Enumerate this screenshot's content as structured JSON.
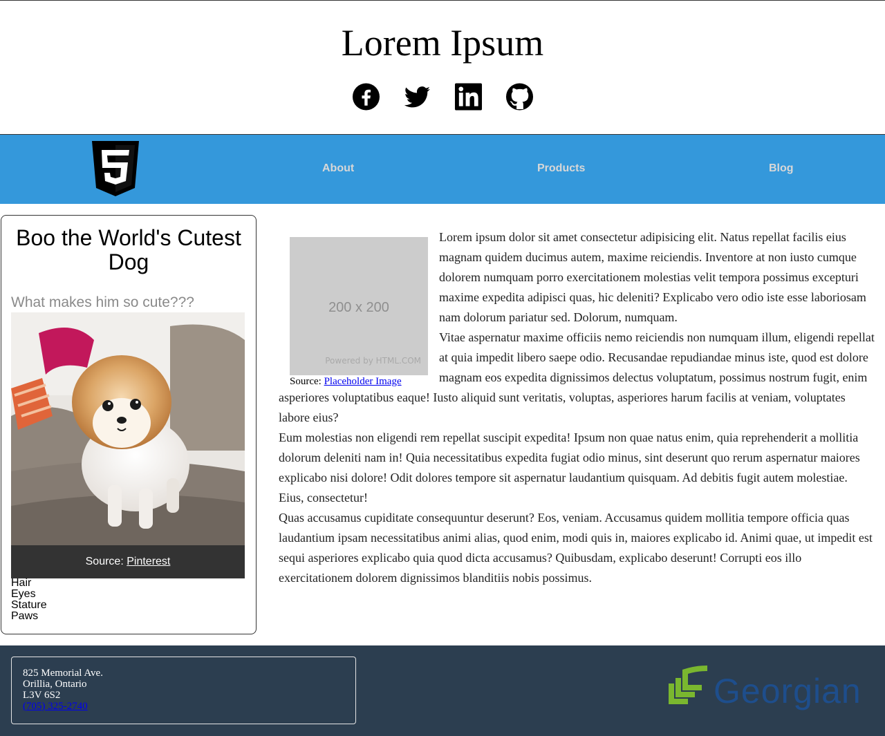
{
  "header": {
    "title": "Lorem Ipsum",
    "social": [
      "facebook-icon",
      "twitter-icon",
      "linkedin-icon",
      "github-icon"
    ]
  },
  "nav": {
    "logo_icon": "html5-icon",
    "links": [
      "About",
      "Products",
      "Blog"
    ]
  },
  "aside": {
    "title": "Boo the World's Cutest Dog",
    "subtitle": "What makes him so cute???",
    "caption_prefix": "Source: ",
    "caption_link": "Pinterest",
    "traits": [
      "Hair",
      "Eyes",
      "Stature",
      "Paws"
    ]
  },
  "article": {
    "placeholder_size": "200 x 200",
    "placeholder_powered": "Powered by HTML.COM",
    "placeholder_caption_prefix": "Source: ",
    "placeholder_caption_link": "Placeholder Image",
    "paragraphs": [
      "Lorem ipsum dolor sit amet consectetur adipisicing elit. Natus repellat facilis eius magnam quidem ducimus autem, maxime reiciendis. Inventore at non iusto cumque dolorem numquam porro exercitationem molestias velit tempora possimus excepturi maxime expedita adipisci quas, hic deleniti? Explicabo vero odio iste esse laboriosam nam dolorum pariatur sed. Dolorum, numquam.",
      "Vitae aspernatur maxime officiis nemo reiciendis non numquam illum, eligendi repellat at quia impedit libero saepe odio. Recusandae repudiandae minus iste, quod est dolore magnam eos expedita dignissimos delectus voluptatum, possimus nostrum fugit, enim asperiores voluptatibus eaque! Iusto aliquid sunt veritatis, voluptas, asperiores harum facilis at veniam, voluptates labore eius?",
      "Eum molestias non eligendi rem repellat suscipit expedita! Ipsum non quae natus enim, quia reprehenderit a mollitia dolorum deleniti nam in! Quia necessitatibus expedita fugiat odio minus, sint deserunt quo rerum aspernatur maiores explicabo nisi dolore! Odit dolores tempore sit aspernatur laudantium quisquam. Ad debitis fugit autem molestiae. Eius, consectetur!",
      "Quas accusamus cupiditate consequuntur deserunt? Eos, veniam. Accusamus quidem mollitia tempore officia quas laudantium ipsam necessitatibus animi alias, quod enim, modi quis in, maiores explicabo id. Animi quae, ut impedit est sequi asperiores explicabo quia quod dicta accusamus? Quibusdam, explicabo deserunt! Corrupti eos illo exercitationem dolorem dignissimos blanditiis nobis possimus."
    ]
  },
  "footer": {
    "address": [
      "825 Memorial Ave.",
      "Orillia, Ontario",
      "L3V 6S2"
    ],
    "phone": "(705) 325-2740",
    "logo_text": "Georgian"
  },
  "colors": {
    "nav_bg": "#3498db",
    "footer_bg": "#2c3e50",
    "georgian_green": "#7ab72f",
    "georgian_blue": "#1e4e8c"
  }
}
